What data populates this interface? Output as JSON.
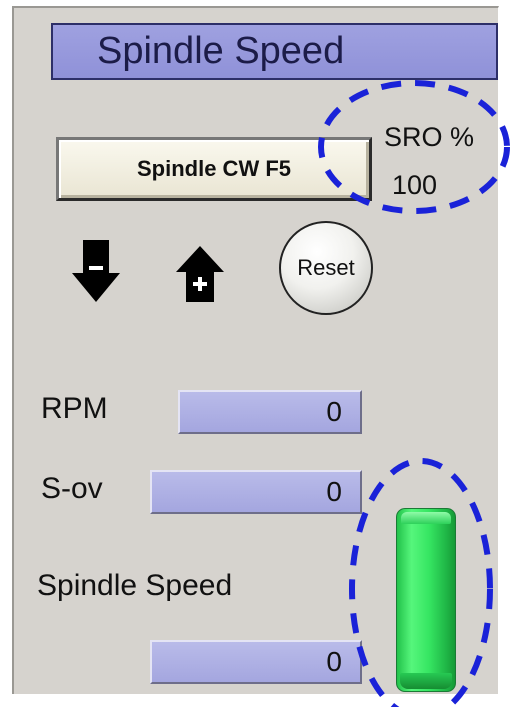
{
  "title": "Spindle Speed",
  "spindle_button": {
    "label": "Spindle CW F5"
  },
  "sro": {
    "label": "SRO %",
    "value": "100"
  },
  "speed_down_icon": "arrow-down-minus-icon",
  "speed_up_icon": "house-plus-icon",
  "reset_button": {
    "label": "Reset"
  },
  "rpm": {
    "label": "RPM",
    "value": "0"
  },
  "sov": {
    "label": "S-ov",
    "value": "0"
  },
  "spindle_speed": {
    "label": "Spindle Speed",
    "value": "0"
  },
  "speed_bar": {
    "level": 1.0,
    "color": "#36e662"
  },
  "annotation_color": "#1a22d8"
}
